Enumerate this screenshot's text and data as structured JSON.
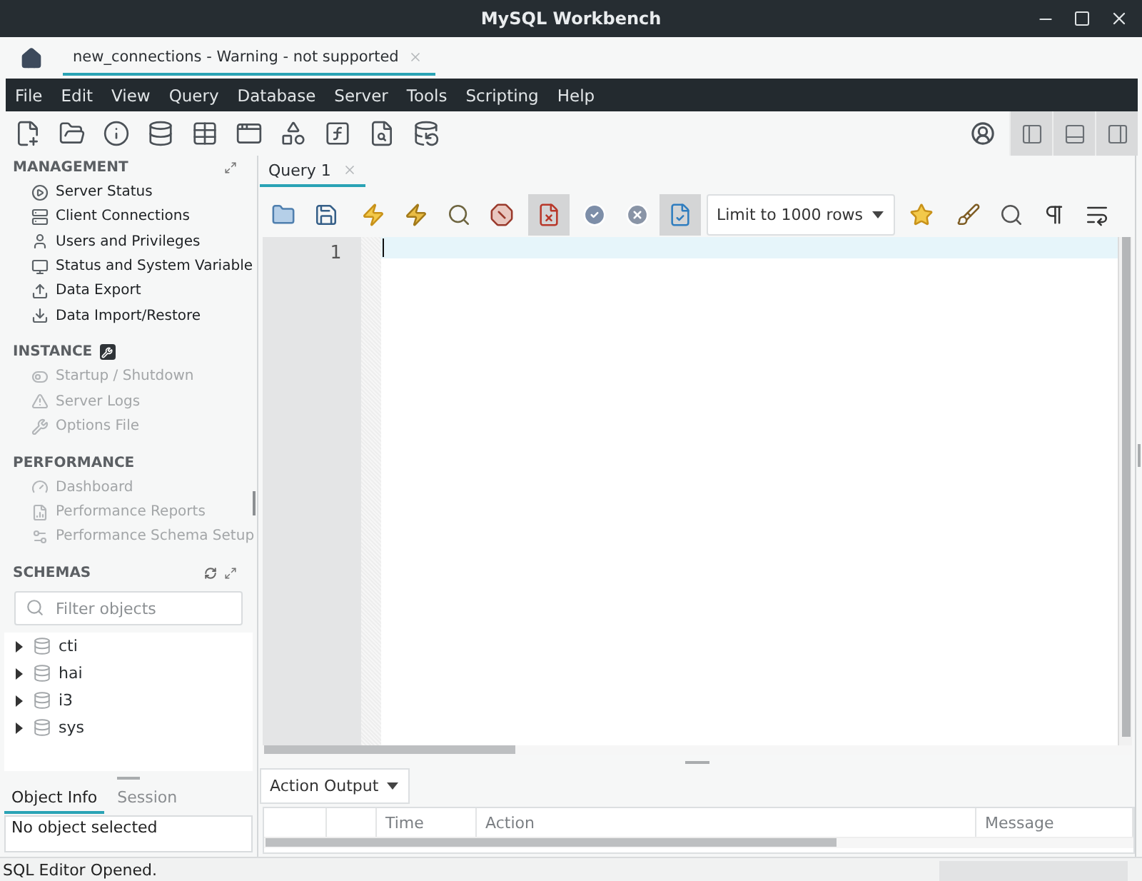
{
  "window": {
    "title": "MySQL Workbench"
  },
  "connection_tabs": [
    {
      "label": "new_connections - Warning - not supported",
      "selected": true
    }
  ],
  "menu": [
    "File",
    "Edit",
    "View",
    "Query",
    "Database",
    "Server",
    "Tools",
    "Scripting",
    "Help"
  ],
  "panel_toggles": [
    {
      "on": true
    },
    {
      "on": true
    },
    {
      "on": true
    }
  ],
  "sidebar": {
    "sections": [
      {
        "title": "MANAGEMENT",
        "items": [
          {
            "label": "Server Status",
            "disabled": false
          },
          {
            "label": "Client Connections",
            "disabled": false
          },
          {
            "label": "Users and Privileges",
            "disabled": false
          },
          {
            "label": "Status and System Variable",
            "disabled": false
          },
          {
            "label": "Data Export",
            "disabled": false
          },
          {
            "label": "Data Import/Restore",
            "disabled": false
          }
        ]
      },
      {
        "title": "INSTANCE",
        "items": [
          {
            "label": "Startup / Shutdown",
            "disabled": true
          },
          {
            "label": "Server Logs",
            "disabled": true
          },
          {
            "label": "Options File",
            "disabled": true
          }
        ]
      },
      {
        "title": "PERFORMANCE",
        "items": [
          {
            "label": "Dashboard",
            "disabled": true
          },
          {
            "label": "Performance Reports",
            "disabled": true
          },
          {
            "label": "Performance Schema Setup",
            "disabled": true
          }
        ]
      }
    ],
    "schemas": {
      "title": "SCHEMAS",
      "filter": {
        "placeholder": "Filter objects"
      },
      "items": [
        {
          "label": "cti",
          "expanded": false
        },
        {
          "label": "hai",
          "expanded": false
        },
        {
          "label": "i3",
          "expanded": false
        },
        {
          "label": "sys",
          "expanded": false
        }
      ]
    },
    "info_tabs": [
      {
        "label": "Object Info",
        "selected": true
      },
      {
        "label": "Session",
        "selected": false
      }
    ],
    "info_text": "No object selected"
  },
  "query_tabs": [
    {
      "label": "Query 1",
      "selected": true
    }
  ],
  "query_toolbar": {
    "toggles": [
      {
        "pressed": true
      },
      {
        "pressed": true
      }
    ],
    "limit": {
      "value": "Limit to 1000 rows"
    }
  },
  "editor": {
    "line_numbers": [
      "1"
    ]
  },
  "output": {
    "selector": "Action Output",
    "columns": [
      "Time",
      "Action",
      "Message"
    ]
  },
  "status_bar": {
    "message": "SQL Editor Opened."
  }
}
